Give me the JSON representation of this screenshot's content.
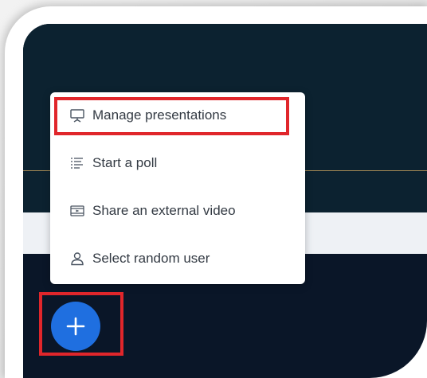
{
  "actions_menu": {
    "items": [
      {
        "label": "Manage presentations",
        "icon": "presentation-icon"
      },
      {
        "label": "Start a poll",
        "icon": "poll-list-icon"
      },
      {
        "label": "Share an external video",
        "icon": "external-video-icon"
      },
      {
        "label": "Select random user",
        "icon": "user-icon"
      }
    ]
  },
  "actions_button": {
    "icon": "plus-icon",
    "color": "#1f6fe0"
  },
  "colors": {
    "highlight": "#e0262b",
    "screen_dark": "#0c2230",
    "accent_line": "#a58a55"
  }
}
